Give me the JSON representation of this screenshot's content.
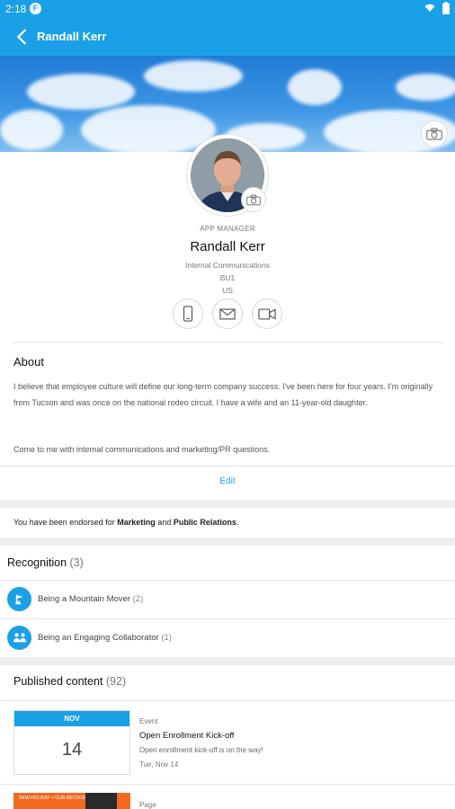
{
  "status_bar": {
    "time": "2:18",
    "badge": "F"
  },
  "app_bar": {
    "title": "Randall Kerr"
  },
  "profile": {
    "role": "APP MANAGER",
    "name": "Randall Kerr",
    "department": "Internal Communications",
    "location_code": "BU1",
    "country": "US"
  },
  "about": {
    "heading": "About",
    "paragraph1": "I believe that employee culture will define our long-term company success. I've been here for four years. I'm originally from Tucson and was once on the national rodeo circuit. I have a wife and an 11-year-old daughter.",
    "paragraph2": "Come to me with internal communications and marketing/PR questions.",
    "edit_label": "Edit"
  },
  "endorsement": {
    "prefix": "You have been endorsed for ",
    "skill1": "Marketing",
    "joiner": " and ",
    "skill2": "Public Relations",
    "suffix": "."
  },
  "recognition": {
    "heading": "Recognition",
    "count": "(3)",
    "items": [
      {
        "label": "Being a Mountain Mover",
        "count": "(2)",
        "icon": "mountain-flag-icon"
      },
      {
        "label": "Being an Engaging Collaborator",
        "count": "(1)",
        "icon": "handshake-icon"
      }
    ]
  },
  "published": {
    "heading": "Published content",
    "count": "(92)",
    "items": [
      {
        "type": "Event",
        "month": "NOV",
        "day": "14",
        "title": "Open Enrollment Kick-off",
        "description": "Open enrollment kick-off is on the way!",
        "date": "Tue, Nov 14"
      },
      {
        "type": "Page",
        "thumb_text": "NEW\nHOLIDAY + OUR\nRECOGNITION"
      }
    ]
  },
  "colors": {
    "accent": "#1aa0e6",
    "divider": "#e3e3e3",
    "section_gap": "#eeeeee"
  }
}
